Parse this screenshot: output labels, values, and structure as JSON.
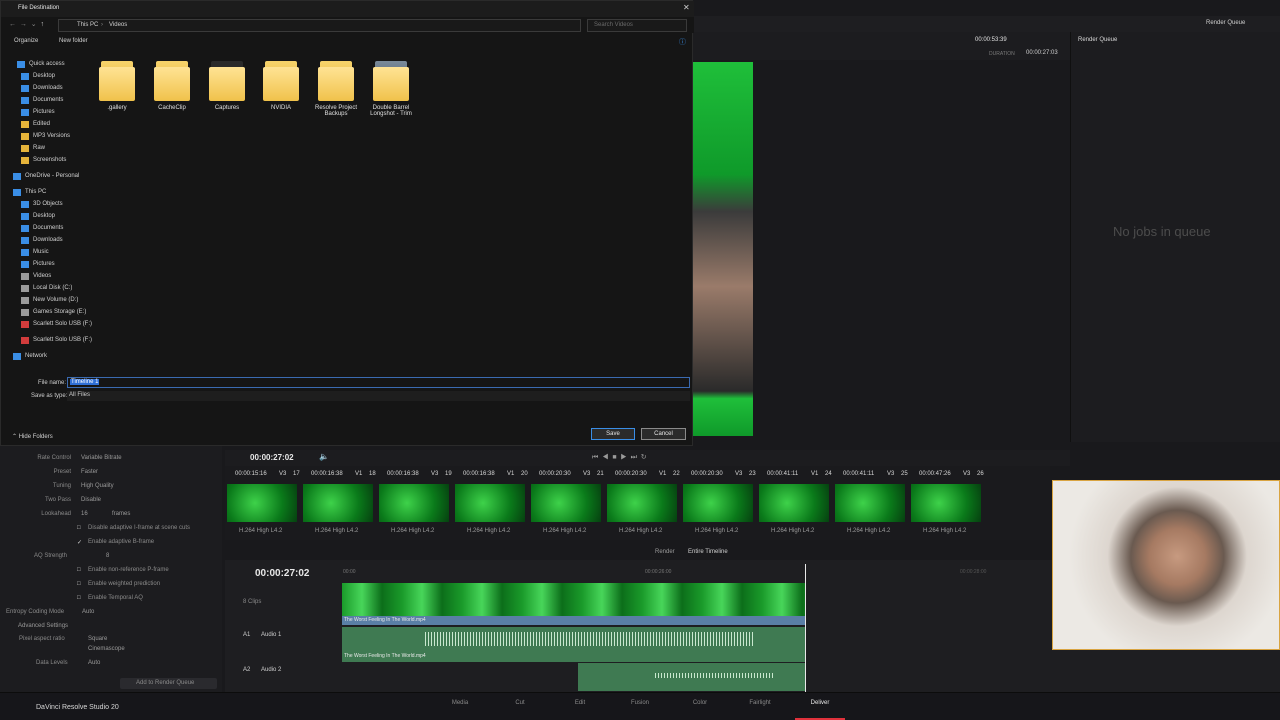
{
  "dialog": {
    "title": "File Destination",
    "breadcrumb": [
      "This PC",
      "Videos"
    ],
    "search_placeholder": "Search Videos",
    "toolbar": {
      "organize": "Organize",
      "new_folder": "New folder"
    },
    "nav": [
      {
        "label": "Quick access",
        "type": "star"
      },
      {
        "label": "Desktop",
        "type": "blue"
      },
      {
        "label": "Downloads",
        "type": "blue"
      },
      {
        "label": "Documents",
        "type": "blue"
      },
      {
        "label": "Pictures",
        "type": "blue"
      },
      {
        "label": "Edited",
        "type": "yellow"
      },
      {
        "label": "MP3 Versions",
        "type": "yellow"
      },
      {
        "label": "Raw",
        "type": "yellow"
      },
      {
        "label": "Screenshots",
        "type": "yellow"
      },
      {
        "label": "OneDrive - Personal",
        "type": "cloud"
      },
      {
        "label": "This PC",
        "type": "pc"
      },
      {
        "label": "3D Objects",
        "type": "blue"
      },
      {
        "label": "Desktop",
        "type": "blue"
      },
      {
        "label": "Documents",
        "type": "blue"
      },
      {
        "label": "Downloads",
        "type": "blue"
      },
      {
        "label": "Music",
        "type": "blue"
      },
      {
        "label": "Pictures",
        "type": "blue"
      },
      {
        "label": "Videos",
        "type": "grey"
      },
      {
        "label": "Local Disk (C:)",
        "type": "drive"
      },
      {
        "label": "New Volume (D:)",
        "type": "drive"
      },
      {
        "label": "Games Storage (E:)",
        "type": "drive"
      },
      {
        "label": "Scarlett Solo USB (F:)",
        "type": "red"
      },
      {
        "label": "Scarlett Solo USB (F:)",
        "type": "red"
      },
      {
        "label": "Network",
        "type": "net"
      }
    ],
    "folders": [
      ".gallery",
      "CacheClip",
      "Captures",
      "NVIDIA",
      "Resolve Project Backups",
      "Double Barrel Longshot - Trim"
    ],
    "file_name_label": "File name:",
    "file_name_value": "Timeline 1",
    "save_type_label": "Save as type:",
    "save_type_value": "All Files",
    "hide_folders": "Hide Folders",
    "save": "Save",
    "cancel": "Cancel"
  },
  "resolve": {
    "timecode_top": "00:00:53:39",
    "duration_label": "DURATION",
    "duration_value": "00:00:27:03",
    "render_queue_title": "Render Queue",
    "render_queue_top": "Render Queue",
    "no_jobs": "No jobs in queue",
    "viewer_timecode": "00:00:27:02",
    "settings": [
      {
        "label": "Rate Control",
        "value": "Variable Bitrate"
      },
      {
        "label": "Preset",
        "value": "Faster"
      },
      {
        "label": "Tuning",
        "value": "High Quality"
      },
      {
        "label": "Two Pass",
        "value": "Disable"
      },
      {
        "label": "Lookahead",
        "value": "16",
        "unit": "frames"
      }
    ],
    "checks": [
      {
        "label": "Disable adaptive I-frame at scene cuts",
        "checked": false
      },
      {
        "label": "Enable adaptive B-frame",
        "checked": true
      }
    ],
    "aq_label": "AQ Strength",
    "aq_value": "8",
    "checks2": [
      {
        "label": "Enable non-reference P-frame",
        "checked": false
      },
      {
        "label": "Enable weighted prediction",
        "checked": false
      },
      {
        "label": "Enable Temporal AQ",
        "checked": false
      }
    ],
    "entropy_label": "Entropy Coding Mode",
    "entropy_value": "Auto",
    "advanced": "Advanced Settings",
    "par_label": "Pixel aspect ratio",
    "par_opts": [
      "Square",
      "Cinemascope"
    ],
    "data_levels_label": "Data Levels",
    "data_levels_value": "Auto",
    "add_to_queue": "Add to Render Queue",
    "clips": [
      {
        "num": "17",
        "tc": "00:00:15:16",
        "track": "V3"
      },
      {
        "num": "18",
        "tc": "00:00:16:38",
        "track": "V1"
      },
      {
        "num": "19",
        "tc": "00:00:16:38",
        "track": "V3"
      },
      {
        "num": "20",
        "tc": "00:00:16:38",
        "track": "V1"
      },
      {
        "num": "21",
        "tc": "00:00:20:30",
        "track": "V3"
      },
      {
        "num": "22",
        "tc": "00:00:20:30",
        "track": "V1"
      },
      {
        "num": "23",
        "tc": "00:00:20:30",
        "track": "V3"
      },
      {
        "num": "24",
        "tc": "00:00:41:11",
        "track": "V1"
      },
      {
        "num": "25",
        "tc": "00:00:41:11",
        "track": "V3"
      },
      {
        "num": "26",
        "tc": "00:00:47:26",
        "track": "V3"
      }
    ],
    "clip_codec": "H.264 High L4.2",
    "render_label": "Render",
    "render_value": "Entire Timeline",
    "timeline_tc": "00:00:27:02",
    "clips_count": "8 Clips",
    "ruler_start": "00:00",
    "ruler_mid": "00:00:26:00",
    "ruler_end": "00:00:28:00",
    "a1": "A1",
    "audio1": "Audio 1",
    "a2": "A2",
    "audio2": "Audio 2",
    "clip_title": "The Worst Feeling In The World.mp4",
    "app_name": "DaVinci Resolve Studio 20",
    "pages": [
      "Media",
      "Cut",
      "Edit",
      "Fusion",
      "Color",
      "Fairlight",
      "Deliver"
    ]
  }
}
